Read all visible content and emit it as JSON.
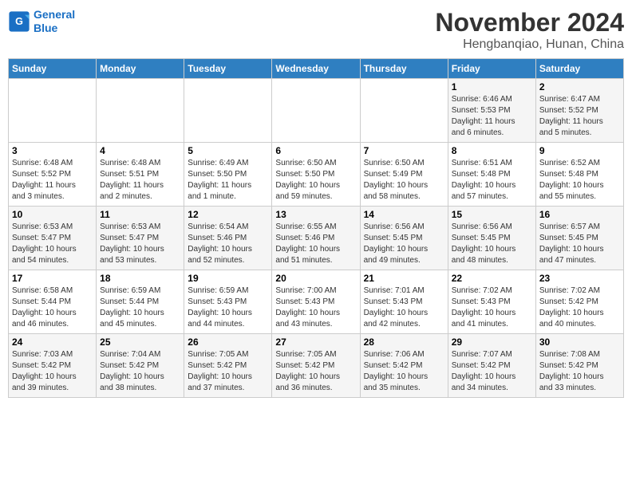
{
  "header": {
    "logo_line1": "General",
    "logo_line2": "Blue",
    "title": "November 2024",
    "subtitle": "Hengbanqiao, Hunan, China"
  },
  "days_of_week": [
    "Sunday",
    "Monday",
    "Tuesday",
    "Wednesday",
    "Thursday",
    "Friday",
    "Saturday"
  ],
  "weeks": [
    [
      {
        "day": "",
        "info": ""
      },
      {
        "day": "",
        "info": ""
      },
      {
        "day": "",
        "info": ""
      },
      {
        "day": "",
        "info": ""
      },
      {
        "day": "",
        "info": ""
      },
      {
        "day": "1",
        "info": "Sunrise: 6:46 AM\nSunset: 5:53 PM\nDaylight: 11 hours\nand 6 minutes."
      },
      {
        "day": "2",
        "info": "Sunrise: 6:47 AM\nSunset: 5:52 PM\nDaylight: 11 hours\nand 5 minutes."
      }
    ],
    [
      {
        "day": "3",
        "info": "Sunrise: 6:48 AM\nSunset: 5:52 PM\nDaylight: 11 hours\nand 3 minutes."
      },
      {
        "day": "4",
        "info": "Sunrise: 6:48 AM\nSunset: 5:51 PM\nDaylight: 11 hours\nand 2 minutes."
      },
      {
        "day": "5",
        "info": "Sunrise: 6:49 AM\nSunset: 5:50 PM\nDaylight: 11 hours\nand 1 minute."
      },
      {
        "day": "6",
        "info": "Sunrise: 6:50 AM\nSunset: 5:50 PM\nDaylight: 10 hours\nand 59 minutes."
      },
      {
        "day": "7",
        "info": "Sunrise: 6:50 AM\nSunset: 5:49 PM\nDaylight: 10 hours\nand 58 minutes."
      },
      {
        "day": "8",
        "info": "Sunrise: 6:51 AM\nSunset: 5:48 PM\nDaylight: 10 hours\nand 57 minutes."
      },
      {
        "day": "9",
        "info": "Sunrise: 6:52 AM\nSunset: 5:48 PM\nDaylight: 10 hours\nand 55 minutes."
      }
    ],
    [
      {
        "day": "10",
        "info": "Sunrise: 6:53 AM\nSunset: 5:47 PM\nDaylight: 10 hours\nand 54 minutes."
      },
      {
        "day": "11",
        "info": "Sunrise: 6:53 AM\nSunset: 5:47 PM\nDaylight: 10 hours\nand 53 minutes."
      },
      {
        "day": "12",
        "info": "Sunrise: 6:54 AM\nSunset: 5:46 PM\nDaylight: 10 hours\nand 52 minutes."
      },
      {
        "day": "13",
        "info": "Sunrise: 6:55 AM\nSunset: 5:46 PM\nDaylight: 10 hours\nand 51 minutes."
      },
      {
        "day": "14",
        "info": "Sunrise: 6:56 AM\nSunset: 5:45 PM\nDaylight: 10 hours\nand 49 minutes."
      },
      {
        "day": "15",
        "info": "Sunrise: 6:56 AM\nSunset: 5:45 PM\nDaylight: 10 hours\nand 48 minutes."
      },
      {
        "day": "16",
        "info": "Sunrise: 6:57 AM\nSunset: 5:45 PM\nDaylight: 10 hours\nand 47 minutes."
      }
    ],
    [
      {
        "day": "17",
        "info": "Sunrise: 6:58 AM\nSunset: 5:44 PM\nDaylight: 10 hours\nand 46 minutes."
      },
      {
        "day": "18",
        "info": "Sunrise: 6:59 AM\nSunset: 5:44 PM\nDaylight: 10 hours\nand 45 minutes."
      },
      {
        "day": "19",
        "info": "Sunrise: 6:59 AM\nSunset: 5:43 PM\nDaylight: 10 hours\nand 44 minutes."
      },
      {
        "day": "20",
        "info": "Sunrise: 7:00 AM\nSunset: 5:43 PM\nDaylight: 10 hours\nand 43 minutes."
      },
      {
        "day": "21",
        "info": "Sunrise: 7:01 AM\nSunset: 5:43 PM\nDaylight: 10 hours\nand 42 minutes."
      },
      {
        "day": "22",
        "info": "Sunrise: 7:02 AM\nSunset: 5:43 PM\nDaylight: 10 hours\nand 41 minutes."
      },
      {
        "day": "23",
        "info": "Sunrise: 7:02 AM\nSunset: 5:42 PM\nDaylight: 10 hours\nand 40 minutes."
      }
    ],
    [
      {
        "day": "24",
        "info": "Sunrise: 7:03 AM\nSunset: 5:42 PM\nDaylight: 10 hours\nand 39 minutes."
      },
      {
        "day": "25",
        "info": "Sunrise: 7:04 AM\nSunset: 5:42 PM\nDaylight: 10 hours\nand 38 minutes."
      },
      {
        "day": "26",
        "info": "Sunrise: 7:05 AM\nSunset: 5:42 PM\nDaylight: 10 hours\nand 37 minutes."
      },
      {
        "day": "27",
        "info": "Sunrise: 7:05 AM\nSunset: 5:42 PM\nDaylight: 10 hours\nand 36 minutes."
      },
      {
        "day": "28",
        "info": "Sunrise: 7:06 AM\nSunset: 5:42 PM\nDaylight: 10 hours\nand 35 minutes."
      },
      {
        "day": "29",
        "info": "Sunrise: 7:07 AM\nSunset: 5:42 PM\nDaylight: 10 hours\nand 34 minutes."
      },
      {
        "day": "30",
        "info": "Sunrise: 7:08 AM\nSunset: 5:42 PM\nDaylight: 10 hours\nand 33 minutes."
      }
    ]
  ]
}
